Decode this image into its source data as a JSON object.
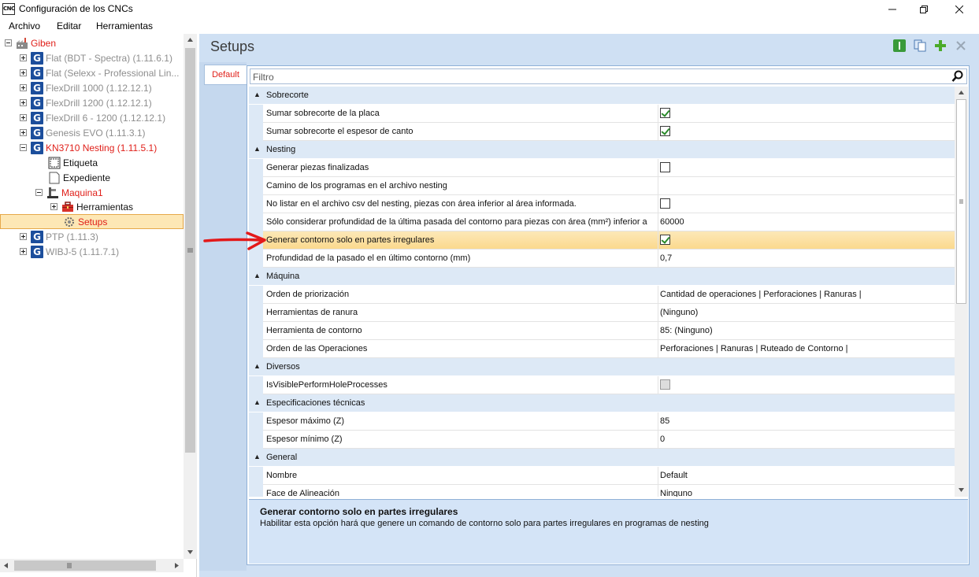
{
  "window": {
    "title": "Configuración de los CNCs",
    "icon_label": "CNC",
    "controls": [
      "minimize",
      "restore",
      "close"
    ]
  },
  "menu": [
    "Archivo",
    "Editar",
    "Herramientas"
  ],
  "tree": {
    "root": "Giben",
    "machines": [
      {
        "label": "Flat (BDT - Spectra) (1.11.6.1)",
        "state": "gray"
      },
      {
        "label": "Flat (Selexx - Professional Lin...",
        "state": "gray"
      },
      {
        "label": "FlexDrill 1000 (1.12.12.1)",
        "state": "gray"
      },
      {
        "label": "FlexDrill 1200 (1.12.12.1)",
        "state": "gray"
      },
      {
        "label": "FlexDrill 6 - 1200 (1.12.12.1)",
        "state": "gray"
      },
      {
        "label": "Genesis EVO (1.11.3.1)",
        "state": "gray"
      },
      {
        "label": "KN3710 Nesting (1.11.5.1)",
        "state": "red"
      },
      {
        "label": "PTP (1.11.3)",
        "state": "gray"
      },
      {
        "label": "WIBJ-5 (1.11.7.1)",
        "state": "gray"
      }
    ],
    "children": {
      "etiqueta": "Etiqueta",
      "expediente": "Expediente",
      "maquina": "Maquina1",
      "herramientas": "Herramientas",
      "setups": "Setups"
    }
  },
  "header": {
    "title": "Setups"
  },
  "tabs": [
    "Default"
  ],
  "filter": {
    "placeholder": "Filtro"
  },
  "grid": {
    "categories": {
      "sobrecorte": "Sobrecorte",
      "nesting": "Nesting",
      "maquina": "Máquina",
      "diversos": "Diversos",
      "especificaciones": "Especificaciones técnicas",
      "general": "General"
    },
    "properties": {
      "p1": {
        "name": "Sumar sobrecorte de la placa",
        "checked": true
      },
      "p2": {
        "name": "Sumar sobrecorte el espesor de canto",
        "checked": true
      },
      "p3": {
        "name": "Generar piezas finalizadas",
        "checked": false
      },
      "p4": {
        "name": "Camino de los programas en el archivo nesting",
        "value": ""
      },
      "p5": {
        "name": "No listar en el archivo csv del nesting, piezas con área inferior al área informada.",
        "checked": false
      },
      "p6": {
        "name": "Sólo considerar profundidad de la última pasada del contorno para piezas con área (mm²) inferior a",
        "value": "60000"
      },
      "p7": {
        "name": "Generar contorno solo en partes irregulares",
        "checked": true
      },
      "p8": {
        "name": "Profundidad de la pasado el en último contorno (mm)",
        "value": "0,7"
      },
      "p9": {
        "name": "Orden de priorización",
        "value": "Cantidad de operaciones | Perforaciones | Ranuras |"
      },
      "p10": {
        "name": "Herramientas de ranura",
        "value": "(Ninguno)"
      },
      "p11": {
        "name": "Herramienta de contorno",
        "value": "85: (Ninguno)"
      },
      "p12": {
        "name": "Orden de las Operaciones",
        "value": "Perforaciones | Ranuras | Ruteado de Contorno |"
      },
      "p13": {
        "name": "IsVisiblePerformHoleProcesses",
        "checked": false
      },
      "p14": {
        "name": "Espesor máximo (Z)",
        "value": "85"
      },
      "p15": {
        "name": "Espesor mínimo (Z)",
        "value": "0"
      },
      "p16": {
        "name": "Nombre",
        "value": "Default"
      },
      "p17": {
        "name": "Face de Alineación",
        "value": "Ninguno"
      }
    }
  },
  "description": {
    "title": "Generar contorno solo en partes irregulares",
    "text": "Habilitar esta opción hará que genere un comando de contorno solo para partes irregulares en programas de nesting"
  },
  "colors": {
    "accent_red": "#e0201a",
    "category_bg": "#dde9f6",
    "selection": "#fbd98d",
    "pane_bg": "#cfe0f3",
    "icon_blue": "#1c4e9c"
  }
}
